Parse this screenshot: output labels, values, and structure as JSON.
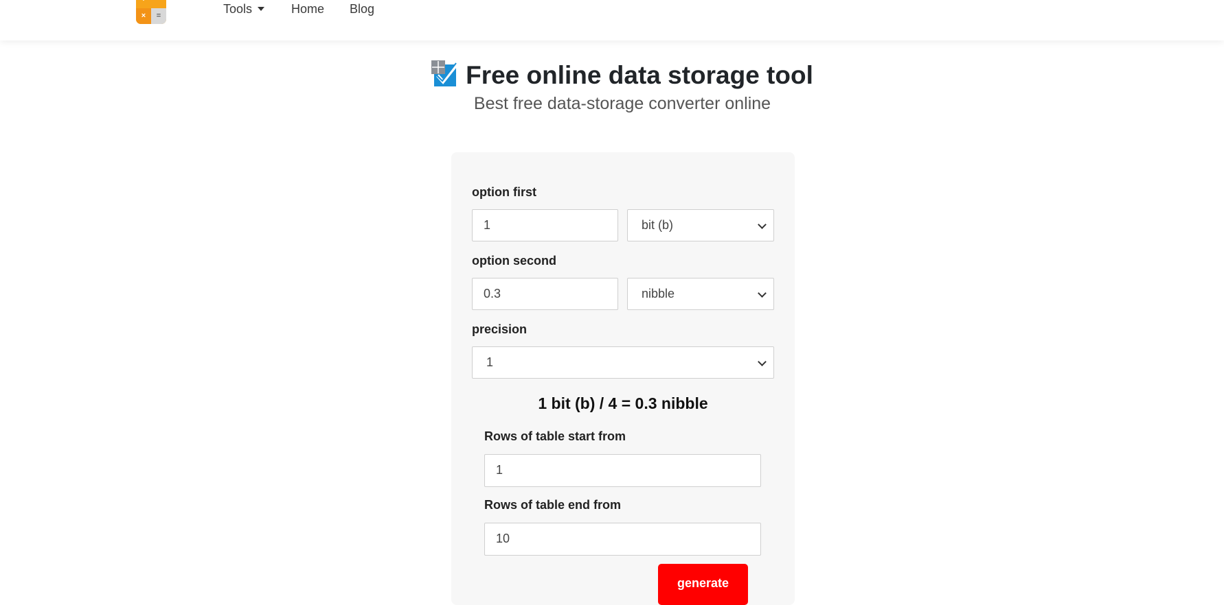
{
  "nav": {
    "tools_label": "Tools",
    "home_label": "Home",
    "blog_label": "Blog"
  },
  "logo": {
    "symbols": [
      "+",
      "−",
      "×",
      "="
    ],
    "color": "#f7a41a"
  },
  "header": {
    "title": "Free online data storage tool",
    "subtitle": "Best free data-storage converter online"
  },
  "form": {
    "option_first_label": "option first",
    "option_first_value": "1",
    "option_first_unit": "bit (b)",
    "option_second_label": "option second",
    "option_second_value": "0.3",
    "option_second_unit": "nibble",
    "precision_label": "precision",
    "precision_value": "1",
    "result_text": "1 bit (b) / 4 = 0.3 nibble",
    "rows_start_label": "Rows of table start from",
    "rows_start_value": "1",
    "rows_end_label": "Rows of table end from",
    "rows_end_value": "10",
    "generate_label": "generate"
  },
  "colors": {
    "accent_button": "#ff0000",
    "card_background": "#f7f7f7",
    "check_icon": "#1a8fd6"
  },
  "icons": [
    "calculator-logo-icon",
    "chevron-down-icon",
    "checklist-icon"
  ]
}
